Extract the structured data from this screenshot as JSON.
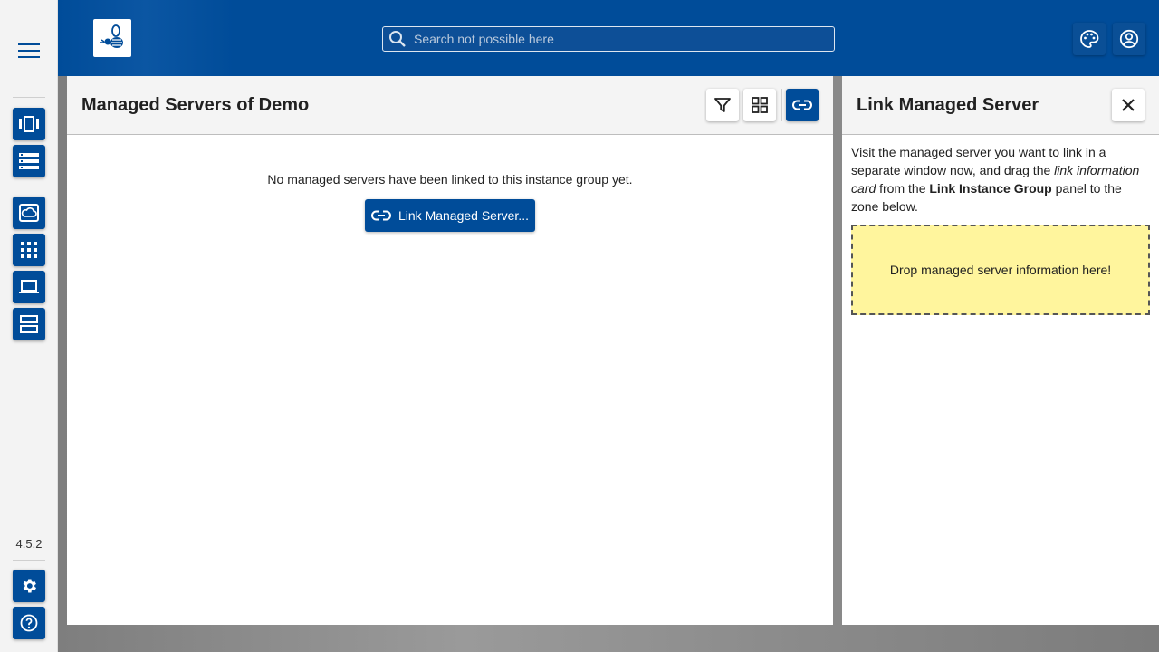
{
  "rail": {
    "version": "4.5.2"
  },
  "header": {
    "search_placeholder": "Search not possible here"
  },
  "main": {
    "title": "Managed Servers of Demo",
    "empty_message": "No managed servers have been linked to this instance group yet.",
    "link_button_label": "Link Managed Server..."
  },
  "side": {
    "title": "Link Managed Server",
    "desc_part1": "Visit the managed server you want to link in a separate window now, and drag the ",
    "desc_italic": "link information card",
    "desc_part2": " from the ",
    "desc_bold": "Link Instance Group",
    "desc_part3": " panel to the zone below.",
    "dropzone_text": "Drop managed server information here!"
  },
  "colors": {
    "primary": "#004c99",
    "dropzone": "#fff59d"
  },
  "icons": [
    "menu-icon",
    "instance-groups-icon",
    "servers-list-icon",
    "cloud-icon",
    "apps-grid-icon",
    "laptop-icon",
    "managed-servers-icon",
    "gear-icon",
    "help-icon",
    "bee-logo-icon",
    "search-icon",
    "palette-icon",
    "account-icon",
    "filter-icon",
    "grid-view-icon",
    "link-icon",
    "close-icon"
  ]
}
